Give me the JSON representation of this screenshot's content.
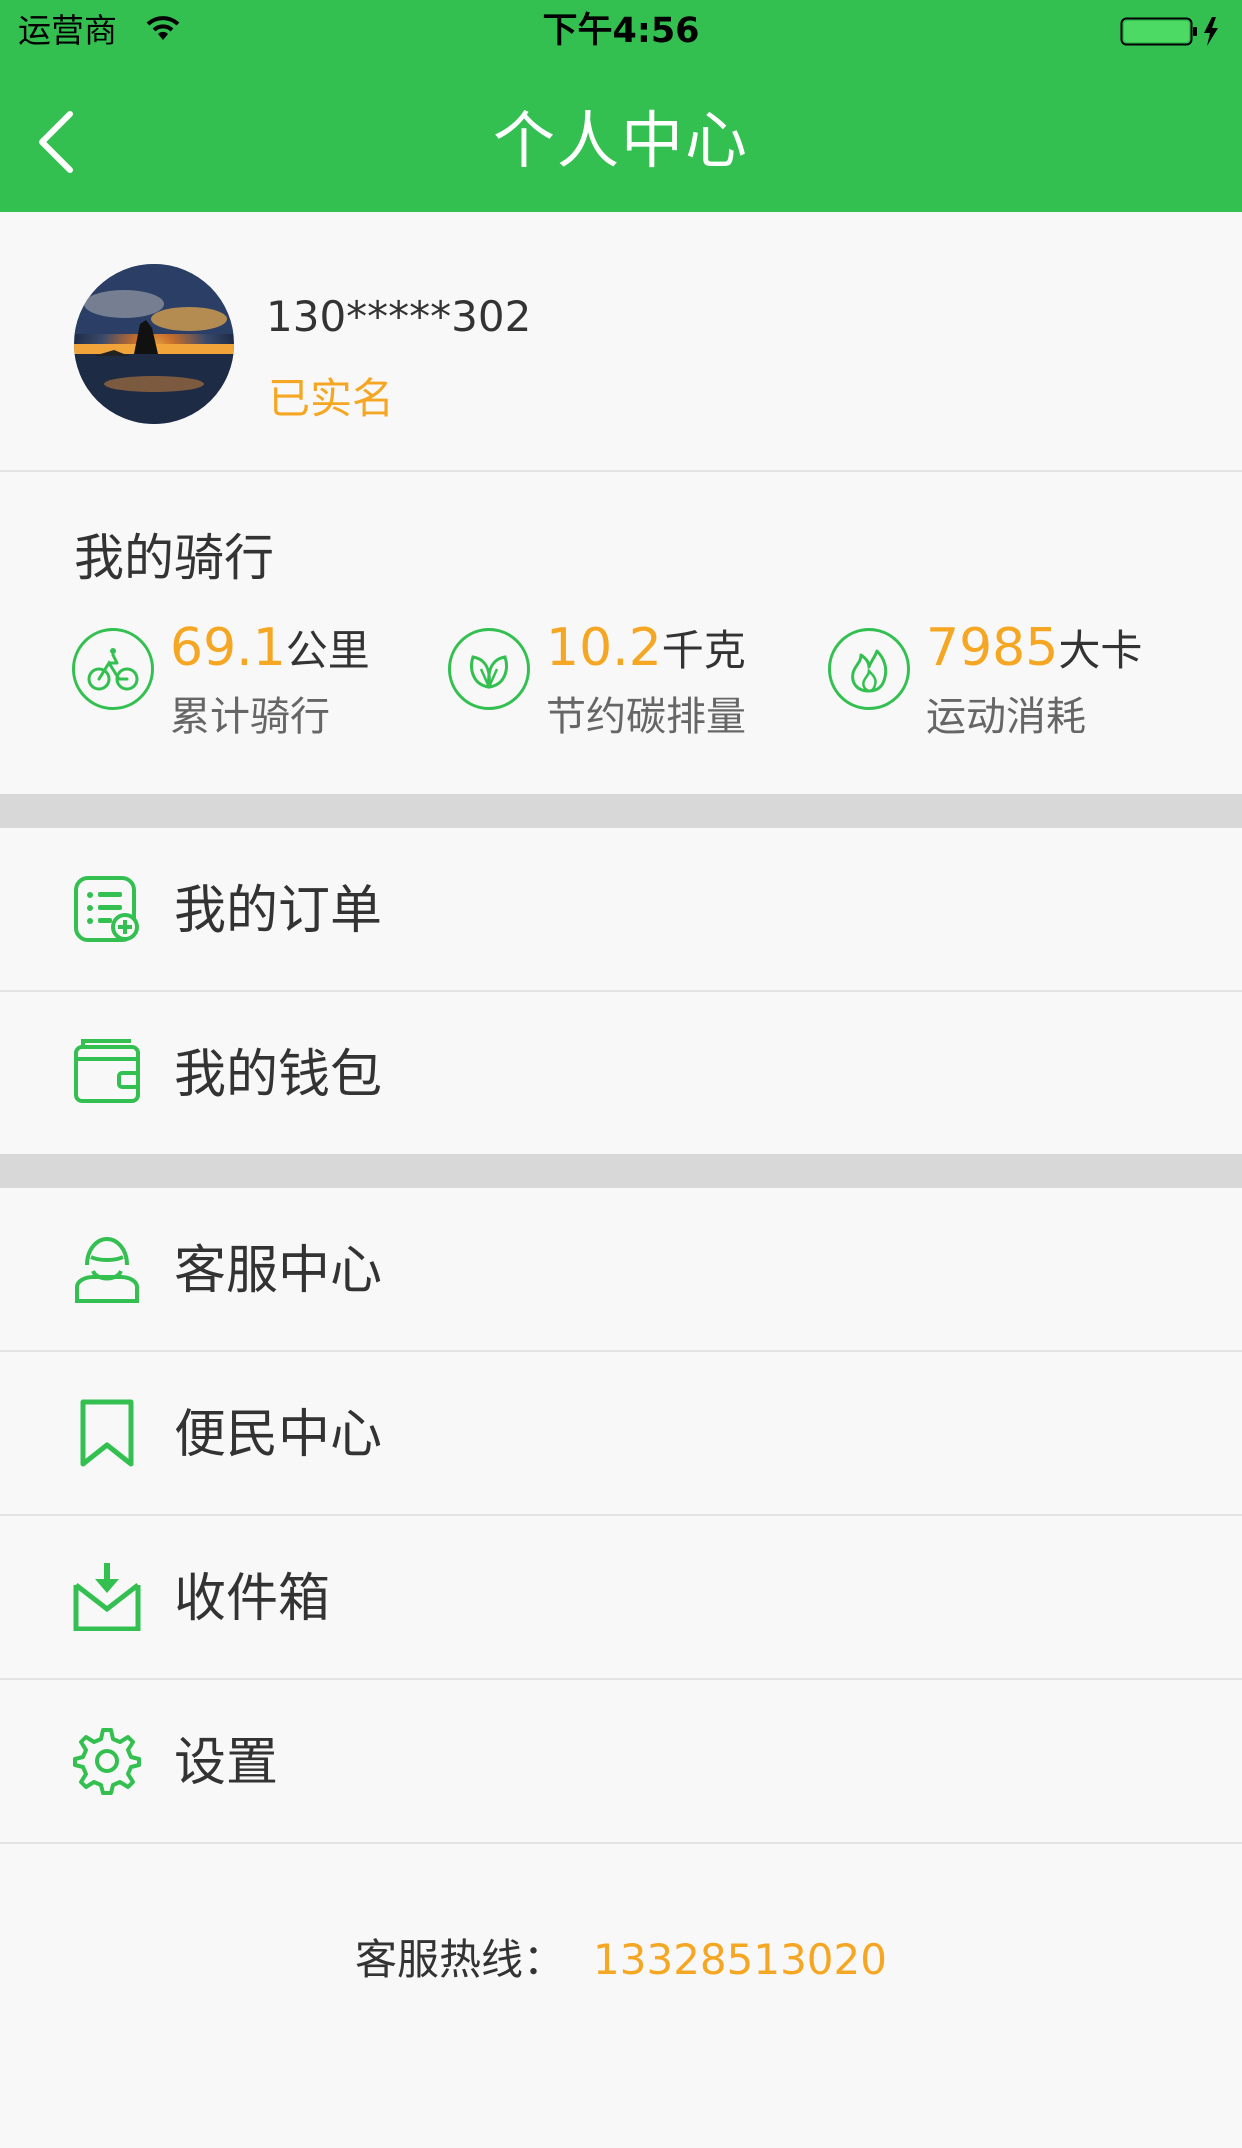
{
  "status_bar": {
    "carrier": "运营商",
    "time": "下午4:56"
  },
  "nav": {
    "title": "个人中心"
  },
  "profile": {
    "phone": "130*****302",
    "verify_status": "已实名"
  },
  "riding": {
    "title": "我的骑行",
    "stats": [
      {
        "value": "69.1",
        "unit": "公里",
        "label": "累计骑行",
        "icon": "bicycle-icon"
      },
      {
        "value": "10.2",
        "unit": "千克",
        "label": "节约碳排量",
        "icon": "leaf-icon"
      },
      {
        "value": "7985",
        "unit": "大卡",
        "label": "运动消耗",
        "icon": "flame-icon"
      }
    ]
  },
  "menu": {
    "orders": "我的订单",
    "wallet": "我的钱包",
    "service": "客服中心",
    "convenience": "便民中心",
    "inbox": "收件箱",
    "settings": "设置"
  },
  "hotline": {
    "label": "客服热线：",
    "number": "13328513020"
  },
  "colors": {
    "primary_green": "#34c050",
    "accent_orange": "#f5a623"
  }
}
